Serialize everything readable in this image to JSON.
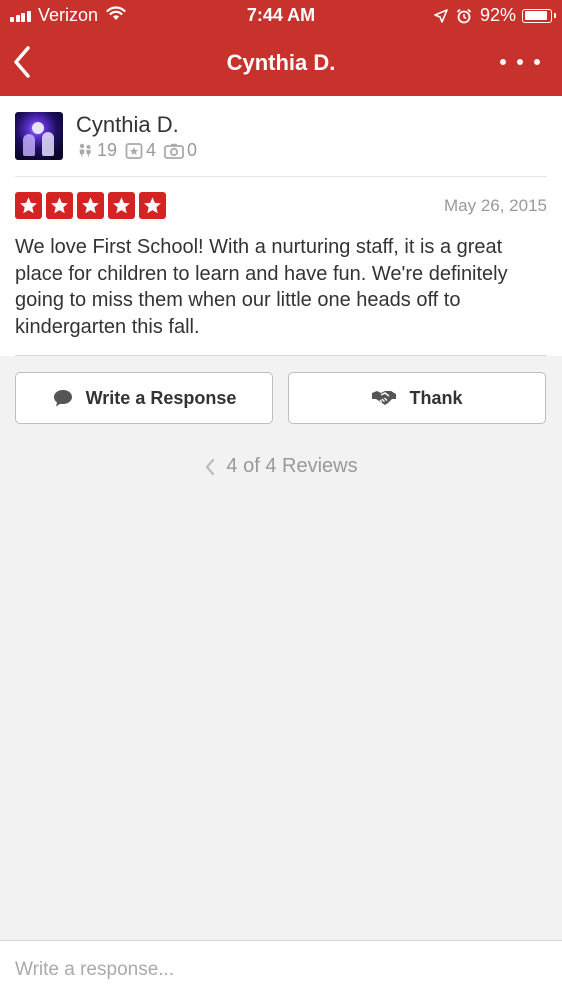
{
  "status_bar": {
    "carrier": "Verizon",
    "time": "7:44 AM",
    "battery": "92%",
    "battery_level": 0.92
  },
  "nav": {
    "title": "Cynthia D.",
    "back_icon": "chevron-left-icon",
    "more_icon": "more-dots-icon"
  },
  "user": {
    "name": "Cynthia D.",
    "friends": "19",
    "reviews": "4",
    "photos": "0"
  },
  "review": {
    "rating": 5,
    "max_rating": 5,
    "date": "May 26, 2015",
    "text": "We love First School! With a nurturing staff, it is a great place for children to learn and have fun. We're definitely going to miss them when our little one heads off to kindergarten this fall."
  },
  "actions": {
    "respond_label": "Write a Response",
    "thank_label": "Thank"
  },
  "pager": {
    "text": "4 of 4 Reviews"
  },
  "compose": {
    "placeholder": "Write a response...",
    "value": ""
  },
  "colors": {
    "brand": "#c8322c",
    "star": "#d32323"
  }
}
